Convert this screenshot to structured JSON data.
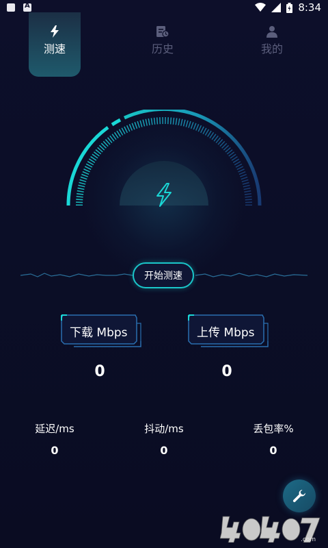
{
  "status_bar": {
    "time": "8:34"
  },
  "tabs": [
    {
      "label": "测速",
      "icon": "bolt-icon",
      "active": true
    },
    {
      "label": "历史",
      "icon": "history-icon",
      "active": false
    },
    {
      "label": "我的",
      "icon": "person-icon",
      "active": false
    }
  ],
  "start_test_label": "开始测速",
  "download": {
    "label": "下载 Mbps",
    "value": "0"
  },
  "upload": {
    "label": "上传 Mbps",
    "value": "0"
  },
  "stats": [
    {
      "label": "延迟/ms",
      "value": "0"
    },
    {
      "label": "抖动/ms",
      "value": "0"
    },
    {
      "label": "丢包率%",
      "value": "0"
    }
  ],
  "watermark": "4O4O7.com",
  "colors": {
    "accent": "#1ac6c9",
    "background": "#0d0f2a",
    "inactive": "#5b5e7c"
  }
}
